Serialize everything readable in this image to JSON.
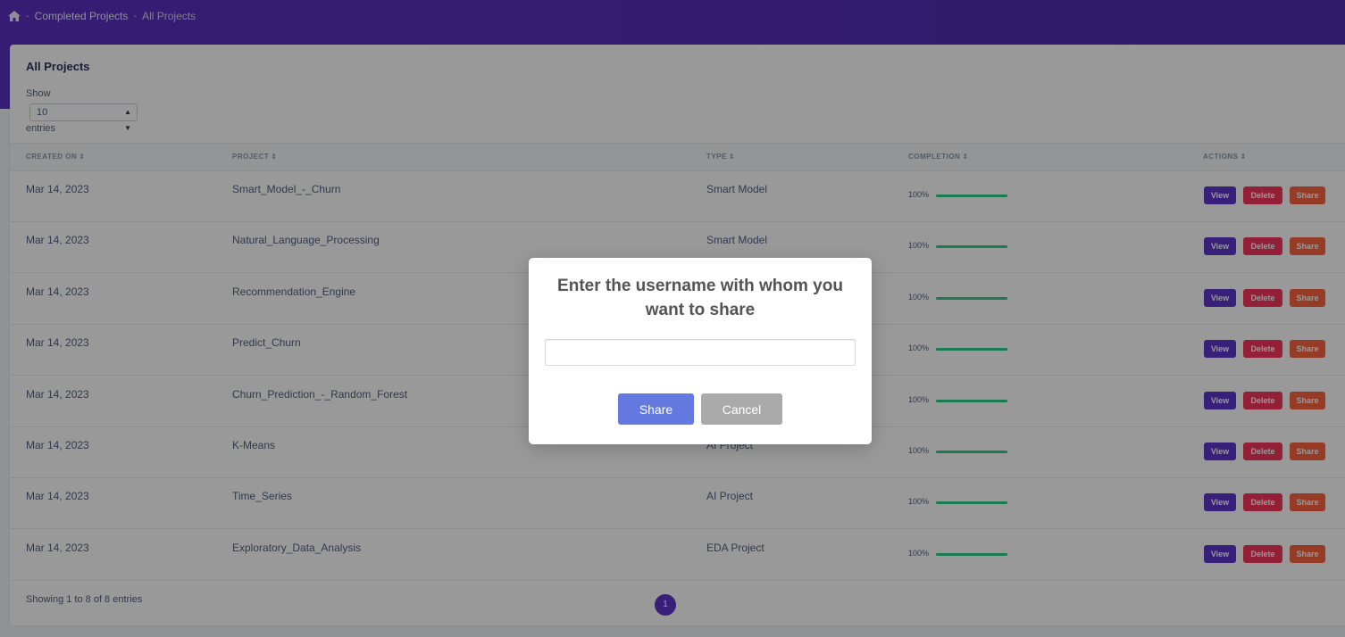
{
  "breadcrumb": {
    "home_icon": "home-icon",
    "items": [
      "Completed Projects",
      "All Projects"
    ]
  },
  "card": {
    "title": "All Projects",
    "show_label": "Show",
    "page_size": "10",
    "entries_label": "entries"
  },
  "table": {
    "headers": [
      "CREATED ON",
      "PROJECT",
      "TYPE",
      "COMPLETION",
      "ACTIONS"
    ],
    "rows": [
      {
        "created": "Mar 14, 2023",
        "project": "Smart_Model_-_Churn",
        "type": "Smart Model",
        "completion": "100%"
      },
      {
        "created": "Mar 14, 2023",
        "project": "Natural_Language_Processing",
        "type": "Smart Model",
        "completion": "100%"
      },
      {
        "created": "Mar 14, 2023",
        "project": "Recommendation_Engine",
        "type": "",
        "completion": "100%"
      },
      {
        "created": "Mar 14, 2023",
        "project": "Predict_Churn",
        "type": "",
        "completion": "100%"
      },
      {
        "created": "Mar 14, 2023",
        "project": "Churn_Prediction_-_Random_Forest",
        "type": "",
        "completion": "100%"
      },
      {
        "created": "Mar 14, 2023",
        "project": "K-Means",
        "type": "AI Project",
        "completion": "100%"
      },
      {
        "created": "Mar 14, 2023",
        "project": "Time_Series",
        "type": "AI Project",
        "completion": "100%"
      },
      {
        "created": "Mar 14, 2023",
        "project": "Exploratory_Data_Analysis",
        "type": "EDA Project",
        "completion": "100%"
      }
    ],
    "completion_fraction": 1.0,
    "actions": {
      "view": "View",
      "delete": "Delete",
      "share": "Share"
    }
  },
  "footer": {
    "summary": "Showing 1 to 8 of 8 entries",
    "current_page": "1"
  },
  "modal": {
    "title": "Enter the username with whom you want to share",
    "input_value": "",
    "share_label": "Share",
    "cancel_label": "Cancel"
  },
  "colors": {
    "header_purple": "#5b2fbf",
    "view_button": "#5e35cc",
    "delete_button": "#f5365c",
    "share_button": "#fb6340",
    "progress": "#2dce89",
    "modal_share": "#6379e0",
    "modal_cancel": "#aaaaaa"
  }
}
